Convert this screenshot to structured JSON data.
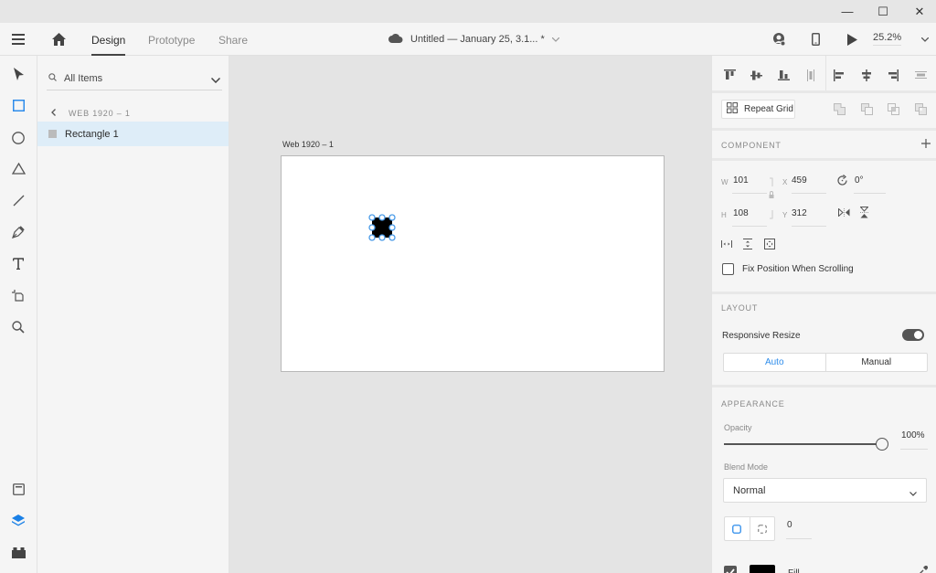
{
  "window": {
    "controls": {
      "minimize": "—",
      "maximize": "☐",
      "close": "✕"
    }
  },
  "appbar": {
    "menu_icon": "hamburger-icon",
    "home_icon": "home-icon",
    "tabs": [
      {
        "label": "Design",
        "active": true
      },
      {
        "label": "Prototype",
        "active": false
      },
      {
        "label": "Share",
        "active": false
      }
    ],
    "document_title": "Untitled — January 25, 3.1... *",
    "zoom_level": "25.2%"
  },
  "toolbar": {
    "tools": [
      "select",
      "rectangle",
      "ellipse",
      "polygon",
      "line",
      "pen",
      "text",
      "artboard",
      "zoom"
    ],
    "bottom": [
      "assets",
      "layers",
      "plugins"
    ]
  },
  "layers": {
    "filter_label": "All Items",
    "breadcrumb": "WEB 1920 – 1",
    "items": [
      {
        "name": "Rectangle 1",
        "selected": true
      }
    ]
  },
  "canvas": {
    "artboard_name": "Web 1920 – 1"
  },
  "properties": {
    "repeat_grid_label": "Repeat Grid",
    "component_title": "COMPONENT",
    "transform": {
      "w_label": "W",
      "w": "101",
      "h_label": "H",
      "h": "108",
      "x_label": "X",
      "x": "459",
      "y_label": "Y",
      "y": "312",
      "rotation": "0°"
    },
    "fix_position_label": "Fix Position When Scrolling",
    "fix_position_checked": false,
    "layout_title": "LAYOUT",
    "responsive_resize_label": "Responsive Resize",
    "responsive_resize_on": true,
    "resize_modes": [
      {
        "label": "Auto",
        "active": true
      },
      {
        "label": "Manual",
        "active": false
      }
    ],
    "appearance_title": "APPEARANCE",
    "opacity_label": "Opacity",
    "opacity_value": "100%",
    "opacity_fraction": 1.0,
    "blend_mode_label": "Blend Mode",
    "blend_mode": "Normal",
    "corner_radius": "0",
    "fill_label": "Fill",
    "fill_checked": true,
    "fill_color": "#000000"
  },
  "colors": {
    "accent": "#2d8ceb",
    "selection": "#4a9be8"
  }
}
